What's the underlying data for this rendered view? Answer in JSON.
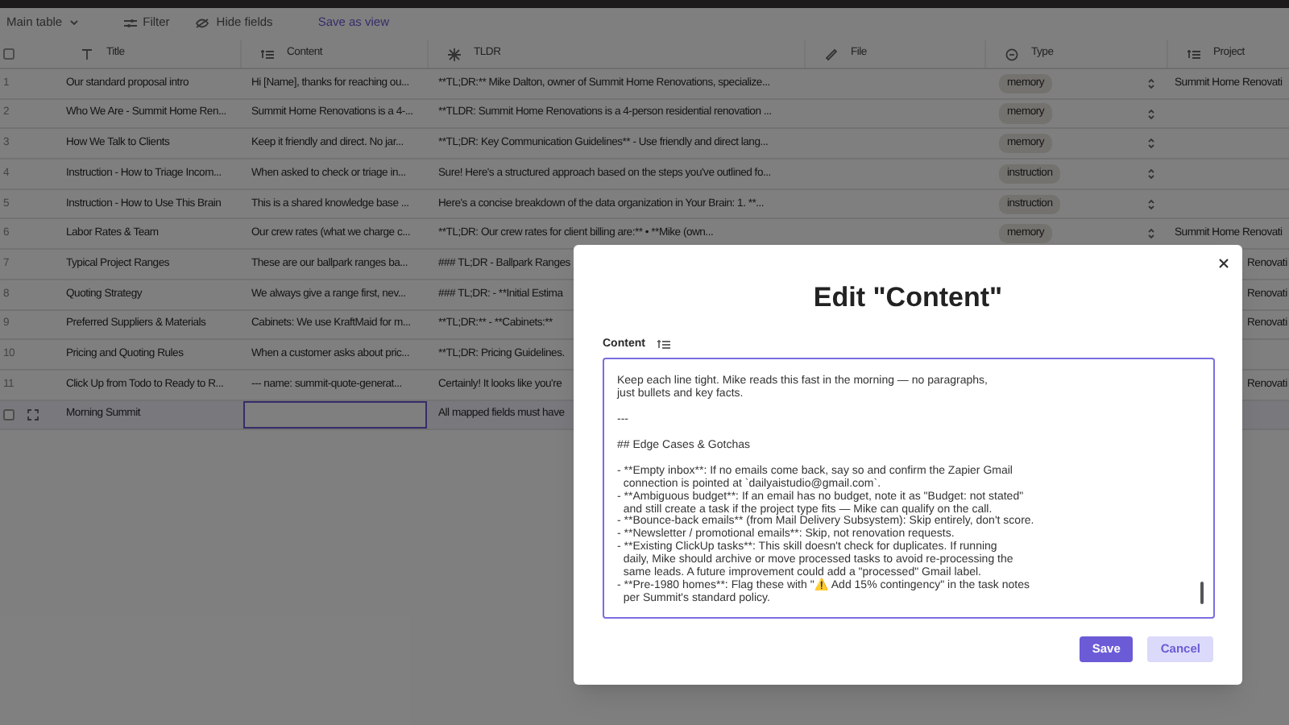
{
  "toolbar": {
    "view": "Main table",
    "filter": "Filter",
    "hide_fields": "Hide fields",
    "save_view": "Save as view"
  },
  "table": {
    "select_all": {
      "checked": false
    },
    "columns": [
      {
        "label": "Title"
      },
      {
        "label": "Content"
      },
      {
        "label": "TLDR"
      },
      {
        "label": "File"
      },
      {
        "label": "Type"
      },
      {
        "label": "Project"
      }
    ],
    "rows": [
      {
        "number": "1",
        "title": "Our standard proposal intro",
        "content": "Hi [Name], thanks for reaching ou...",
        "tldr": "**TL;DR:** Mike Dalton, owner of Summit Home Renovations, specialize...",
        "type": "memory",
        "project": "Summit Home Renovati",
        "selected": false
      },
      {
        "number": "2",
        "title": "Who We Are - Summit Home Ren...",
        "content": "Summit Home Renovations is a 4-...",
        "tldr": "**TLDR: Summit Home Renovations is a 4-person residential renovation ...",
        "type": "memory",
        "selected": false
      },
      {
        "number": "3",
        "title": "How We Talk to Clients",
        "content": "Keep it friendly and direct. No jar...",
        "tldr": "**TL;DR: Key Communication Guidelines** - Use friendly and direct lang...",
        "type": "memory",
        "selected": false
      },
      {
        "number": "4",
        "title": "Instruction - How to Triage Incom...",
        "content": "When asked to check or triage in...",
        "tldr": "Sure! Here's a structured approach based on the steps you've outlined fo...",
        "type": "instruction",
        "selected": false
      },
      {
        "number": "5",
        "title": "Instruction - How to Use This Brain",
        "content": "This is a shared knowledge base ...",
        "tldr": "Here's a concise breakdown of the data organization in Your Brain: 1. **...",
        "type": "instruction",
        "selected": false
      },
      {
        "number": "6",
        "title": "Labor Rates & Team",
        "content": "Our crew rates (what we charge c...",
        "tldr": "**TL;DR: Our crew rates for client billing are:** • **Mike (own...",
        "type": "memory",
        "project": "Summit Home Renovati",
        "selected": false
      },
      {
        "number": "7",
        "title": "Typical Project Ranges",
        "content": "These are our ballpark ranges ba...",
        "tldr": "### TL;DR - Ballpark Ranges",
        "project": "Renovati",
        "selected": false
      },
      {
        "number": "8",
        "title": "Quoting Strategy",
        "content": "We always give a range first, nev...",
        "tldr": "### TL;DR: - **Initial Estima",
        "project": "Renovati",
        "selected": false
      },
      {
        "number": "9",
        "title": "Preferred Suppliers & Materials",
        "content": "Cabinets: We use KraftMaid for m...",
        "tldr": "**TL;DR:** - **Cabinets:**",
        "project": "Renovati",
        "selected": false
      },
      {
        "number": "10",
        "title": "Pricing and Quoting Rules",
        "content": "When a customer asks about pric...",
        "tldr": "**TL;DR: Pricing Guidelines.",
        "selected": false
      },
      {
        "number": "11",
        "title": "Click Up from Todo to Ready to R...",
        "content": "--- name: summit-quote-generat...",
        "tldr": "Certainly! It looks like you're",
        "project": "Renovati",
        "selected": false
      },
      {
        "title": "Morning Summit",
        "tldr": "All mapped fields must have",
        "selected": true
      }
    ]
  },
  "dialog": {
    "title": "Edit \"Content\"",
    "field_label": "Content",
    "value": "Keep each line tight. Mike reads this fast in the morning — no paragraphs,\njust bullets and key facts.\n\n---\n\n## Edge Cases & Gotchas\n\n- **Empty inbox**: If no emails come back, say so and confirm the Zapier Gmail\n  connection is pointed at `dailyaistudio@gmail.com`.\n- **Ambiguous budget**: If an email has no budget, note it as \"Budget: not stated\"\n  and still create a task if the project type fits — Mike can qualify on the call.\n- **Bounce-back emails** (from Mail Delivery Subsystem): Skip entirely, don't score.\n- **Newsletter / promotional emails**: Skip, not renovation requests.\n- **Existing ClickUp tasks**: This skill doesn't check for duplicates. If running\n  daily, Mike should archive or move processed tasks to avoid re-processing the\n  same leads. A future improvement could add a \"processed\" Gmail label.\n- **Pre-1980 homes**: Flag these with \"⚠️ Add 15% contingency\" in the task notes\n  per Summit's standard policy.",
    "buttons": [
      {
        "label": "Save",
        "kind": "primary"
      },
      {
        "label": "Cancel",
        "kind": "secondary"
      }
    ]
  }
}
